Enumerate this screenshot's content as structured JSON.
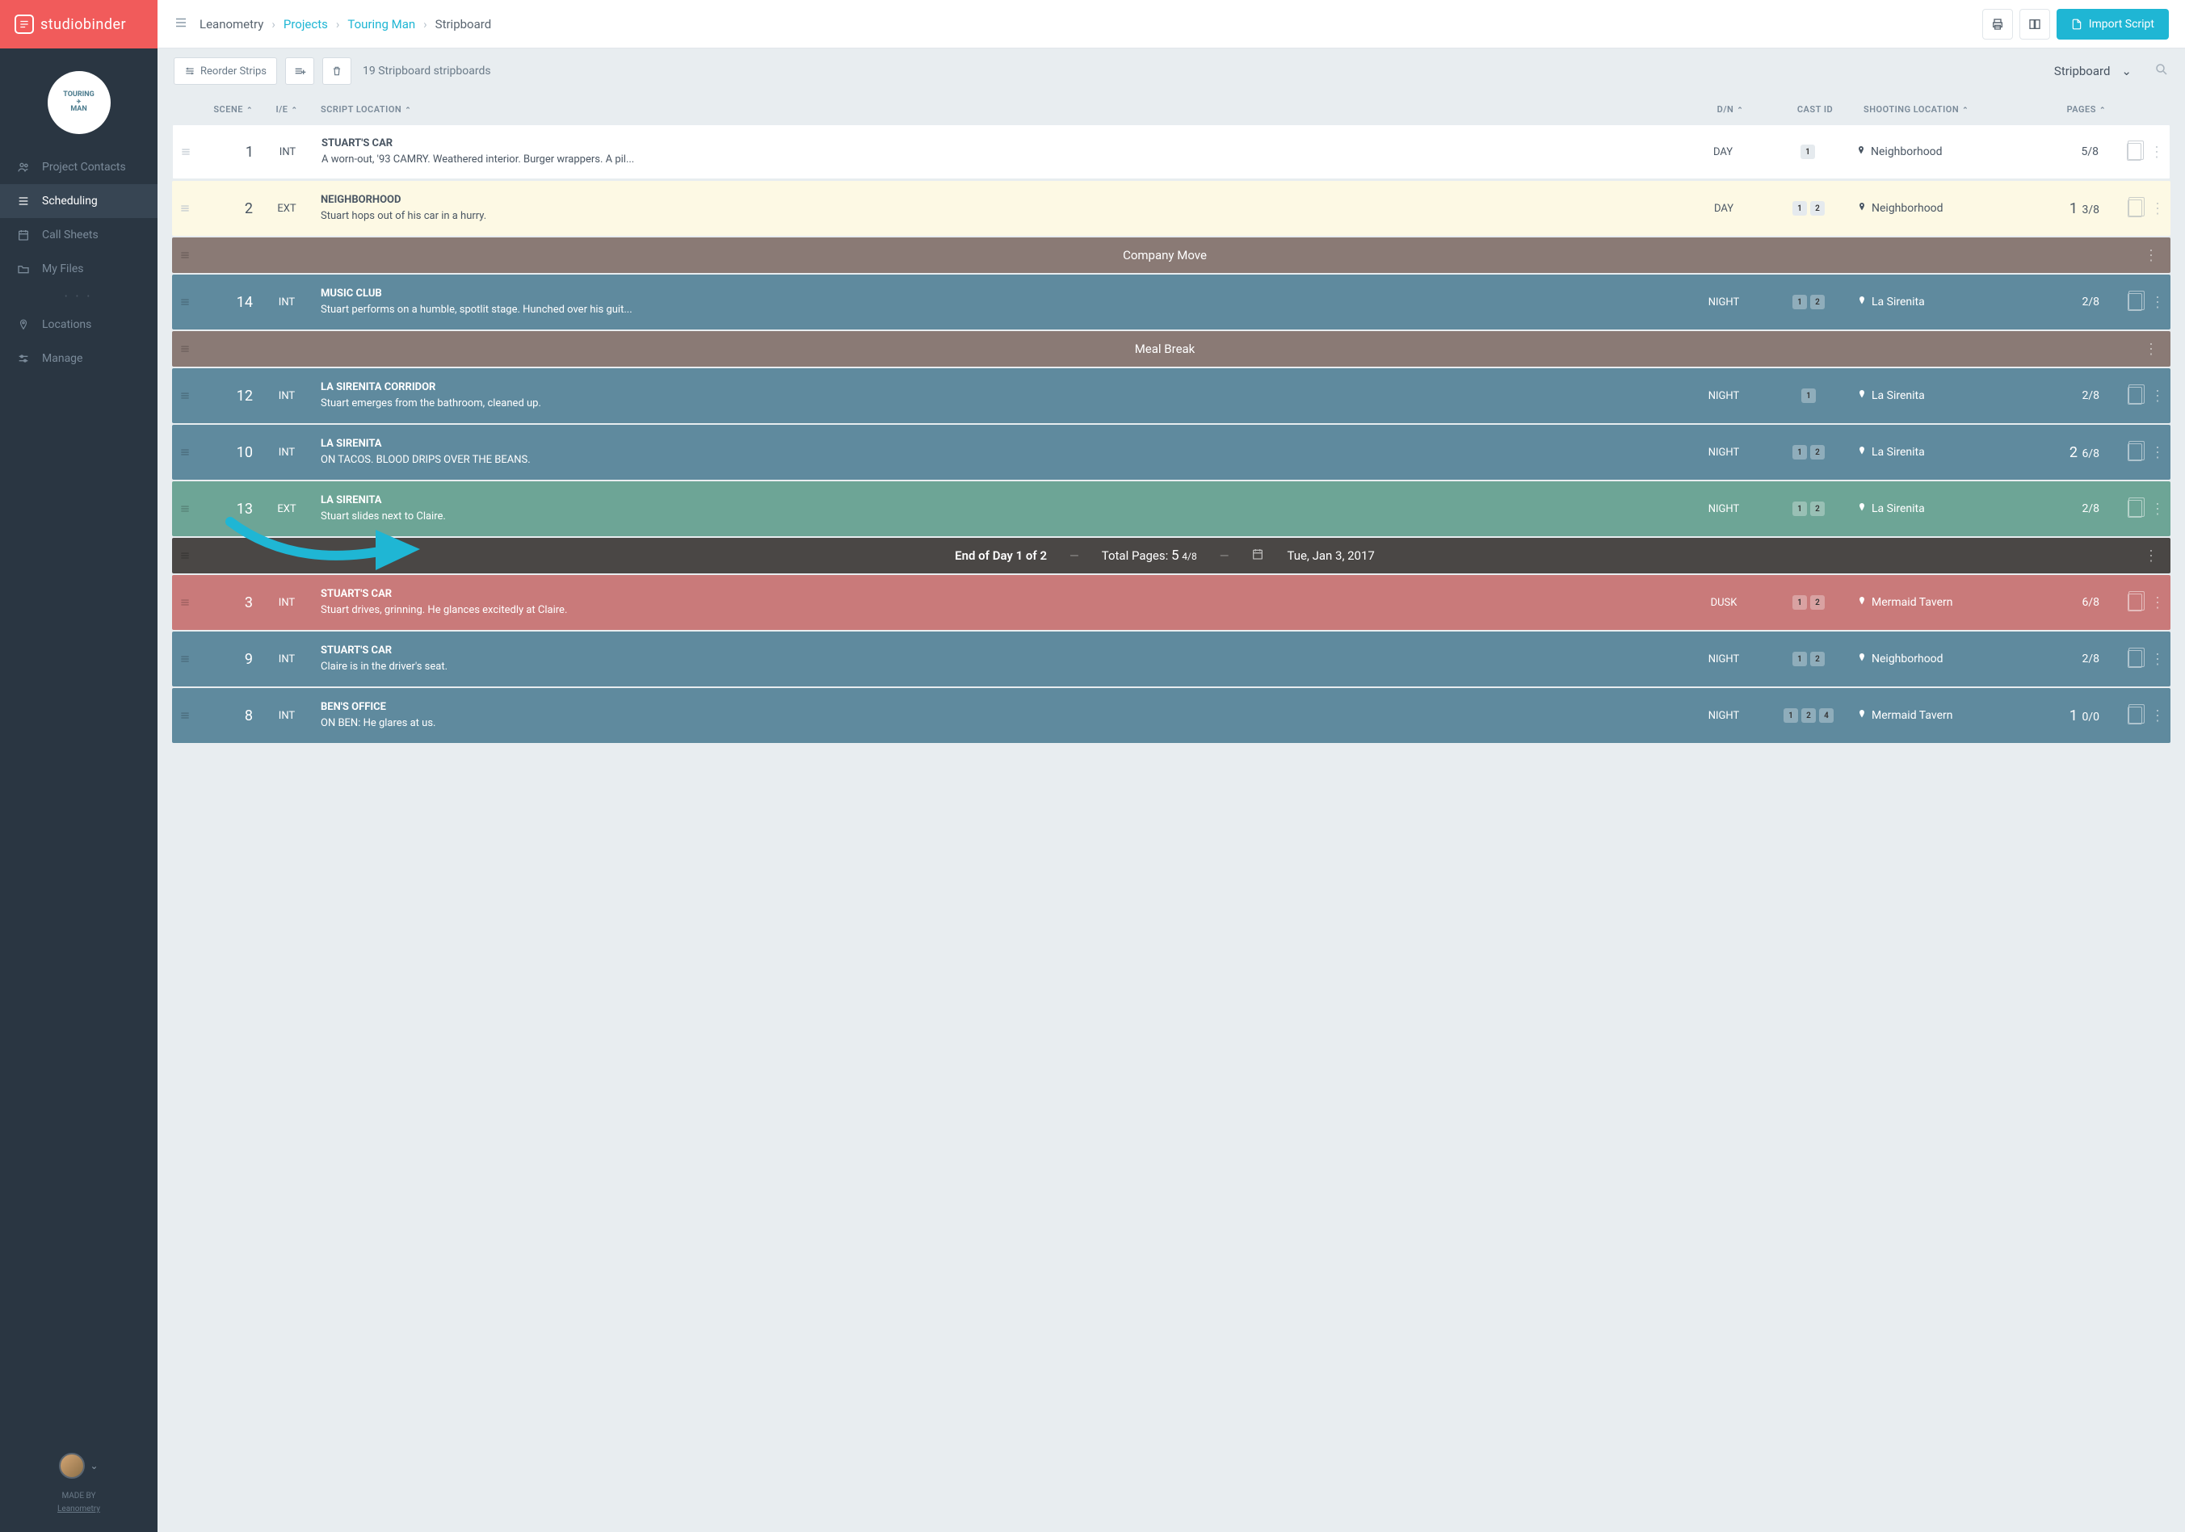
{
  "brand": "studiobinder",
  "project_badge": {
    "line1": "TOURING",
    "line2": "MAN"
  },
  "sidebar": {
    "items": [
      {
        "label": "Project Contacts",
        "icon": "users"
      },
      {
        "label": "Scheduling",
        "icon": "list",
        "active": true
      },
      {
        "label": "Call Sheets",
        "icon": "calendar"
      },
      {
        "label": "My Files",
        "icon": "folder"
      }
    ],
    "items2": [
      {
        "label": "Locations",
        "icon": "pin"
      },
      {
        "label": "Manage",
        "icon": "sliders"
      }
    ],
    "footer": {
      "made_by": "MADE BY",
      "org": "Leanometry"
    }
  },
  "breadcrumb": [
    "Leanometry",
    "Projects",
    "Touring Man",
    "Stripboard"
  ],
  "topbar": {
    "import": "Import Script"
  },
  "toolbar": {
    "reorder": "Reorder Strips",
    "count_label": "19 Stripboard stripboards",
    "view": "Stripboard"
  },
  "columns": {
    "scene": "SCENE",
    "ie": "I/E",
    "loc": "SCRIPT LOCATION",
    "dn": "D/N",
    "cast": "CAST ID",
    "shoot": "SHOOTING LOCATION",
    "pages": "PAGES"
  },
  "banners": {
    "company_move": "Company Move",
    "meal_break": "Meal Break",
    "eod_title": "End of Day 1 of 2",
    "eod_pages_label": "Total Pages:",
    "eod_pages_big": "5",
    "eod_pages_frac": "4/8",
    "eod_date": "Tue, Jan 3, 2017"
  },
  "strips": [
    {
      "kind": "scene",
      "cls": "white",
      "scene": "1",
      "ie": "INT",
      "title": "STUART'S CAR",
      "desc": "A worn-out, '93 CAMRY. Weathered interior. Burger wrappers. A pil...",
      "dn": "DAY",
      "cast": [
        "1"
      ],
      "shoot": "Neighborhood",
      "pages_big": "",
      "pages_frac": "5/8"
    },
    {
      "kind": "scene",
      "cls": "yellow",
      "scene": "2",
      "ie": "EXT",
      "title": "NEIGHBORHOOD",
      "desc": "Stuart hops out of his car in a hurry.",
      "dn": "DAY",
      "cast": [
        "1",
        "2"
      ],
      "shoot": "Neighborhood",
      "pages_big": "1",
      "pages_frac": "3/8"
    },
    {
      "kind": "banner",
      "cls": "banner",
      "textKey": "company_move"
    },
    {
      "kind": "scene",
      "cls": "blue",
      "scene": "14",
      "ie": "INT",
      "title": "MUSIC CLUB",
      "desc": "Stuart performs on a humble, spotlit stage. Hunched over his guit...",
      "dn": "NIGHT",
      "cast": [
        "1",
        "2"
      ],
      "shoot": "La Sirenita",
      "pages_big": "",
      "pages_frac": "2/8"
    },
    {
      "kind": "banner",
      "cls": "banner",
      "textKey": "meal_break"
    },
    {
      "kind": "scene",
      "cls": "blue",
      "scene": "12",
      "ie": "INT",
      "title": "LA SIRENITA CORRIDOR",
      "desc": "Stuart emerges from the bathroom, cleaned up.",
      "dn": "NIGHT",
      "cast": [
        "1"
      ],
      "shoot": "La Sirenita",
      "pages_big": "",
      "pages_frac": "2/8"
    },
    {
      "kind": "scene",
      "cls": "blue",
      "scene": "10",
      "ie": "INT",
      "title": "LA SIRENITA",
      "desc": "ON TACOS. BLOOD DRIPS OVER THE BEANS.",
      "dn": "NIGHT",
      "cast": [
        "1",
        "2"
      ],
      "shoot": "La Sirenita",
      "pages_big": "2",
      "pages_frac": "6/8"
    },
    {
      "kind": "scene",
      "cls": "teal",
      "scene": "13",
      "ie": "EXT",
      "title": "LA SIRENITA",
      "desc": "Stuart slides next to Claire.",
      "dn": "NIGHT",
      "cast": [
        "1",
        "2"
      ],
      "shoot": "La Sirenita",
      "pages_big": "",
      "pages_frac": "2/8"
    },
    {
      "kind": "eod"
    },
    {
      "kind": "scene",
      "cls": "red",
      "scene": "3",
      "ie": "INT",
      "title": "STUART'S CAR",
      "desc": "Stuart drives, grinning. He glances excitedly at Claire.",
      "dn": "DUSK",
      "cast": [
        "1",
        "2"
      ],
      "shoot": "Mermaid Tavern",
      "pages_big": "",
      "pages_frac": "6/8"
    },
    {
      "kind": "scene",
      "cls": "blue",
      "scene": "9",
      "ie": "INT",
      "title": "STUART'S CAR",
      "desc": "Claire is in the driver's seat.",
      "dn": "NIGHT",
      "cast": [
        "1",
        "2"
      ],
      "shoot": "Neighborhood",
      "pages_big": "",
      "pages_frac": "2/8"
    },
    {
      "kind": "scene",
      "cls": "blue",
      "scene": "8",
      "ie": "INT",
      "title": "BEN'S OFFICE",
      "desc": "ON BEN: He glares at us.",
      "dn": "NIGHT",
      "cast": [
        "1",
        "2",
        "4"
      ],
      "shoot": "Mermaid Tavern",
      "pages_big": "1",
      "pages_frac": "0/0"
    }
  ]
}
